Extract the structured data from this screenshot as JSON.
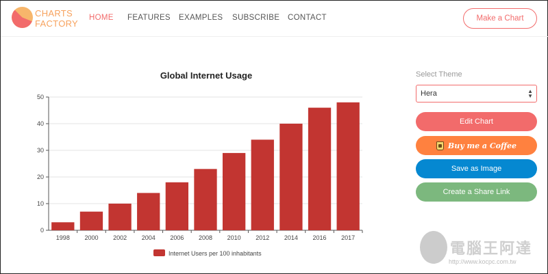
{
  "header": {
    "logo_line1": "CHARTS",
    "logo_line2": "FACTORY",
    "nav": [
      "HOME",
      "FEATURES",
      "EXAMPLES",
      "SUBSCRIBE",
      "CONTACT"
    ],
    "make_chart": "Make a Chart"
  },
  "panel": {
    "theme_label": "Select Theme",
    "theme_value": "Hera",
    "edit": "Edit Chart",
    "coffee": "Buy me a Coffee",
    "save": "Save as Image",
    "share": "Create a Share Link"
  },
  "colors": {
    "accent": "#f26b6b",
    "bar": "#c23531",
    "coffee": "#ff813f",
    "save": "#0588d1",
    "share": "#7cb87e"
  },
  "watermark": {
    "text": "電腦王阿達",
    "url": "http://www.kocpc.com.tw"
  },
  "chart_data": {
    "type": "bar",
    "title": "Global Internet Usage",
    "categories": [
      "1998",
      "2000",
      "2002",
      "2004",
      "2006",
      "2008",
      "2010",
      "2012",
      "2014",
      "2016",
      "2017"
    ],
    "series": [
      {
        "name": "Internet Users per 100 inhabitants",
        "values": [
          3,
          7,
          10,
          14,
          18,
          23,
          29,
          34,
          40,
          46,
          48
        ]
      }
    ],
    "xlabel": "",
    "ylabel": "",
    "ylim": [
      0,
      50
    ],
    "yticks": [
      0,
      10,
      20,
      30,
      40,
      50
    ],
    "grid": true,
    "legend": "bottom"
  }
}
